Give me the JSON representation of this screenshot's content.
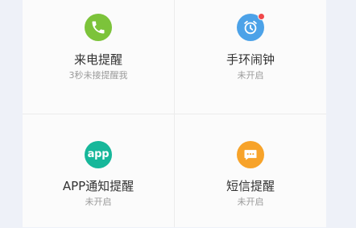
{
  "colors": {
    "call_green": "#7cc33a",
    "alarm_blue": "#4ca2e8",
    "app_teal": "#17b79a",
    "sms_orange": "#f7a32a",
    "badge_red": "#f0484a"
  },
  "tiles": [
    {
      "title": "来电提醒",
      "subtitle": "3秒未接提醒我",
      "icon": "phone-icon"
    },
    {
      "title": "手环闹钟",
      "subtitle": "未开启",
      "icon": "alarm-clock-icon",
      "badge": true
    },
    {
      "title": "APP通知提醒",
      "subtitle": "未开启",
      "icon": "app-icon",
      "icon_text": "app"
    },
    {
      "title": "短信提醒",
      "subtitle": "未开启",
      "icon": "sms-icon"
    }
  ]
}
